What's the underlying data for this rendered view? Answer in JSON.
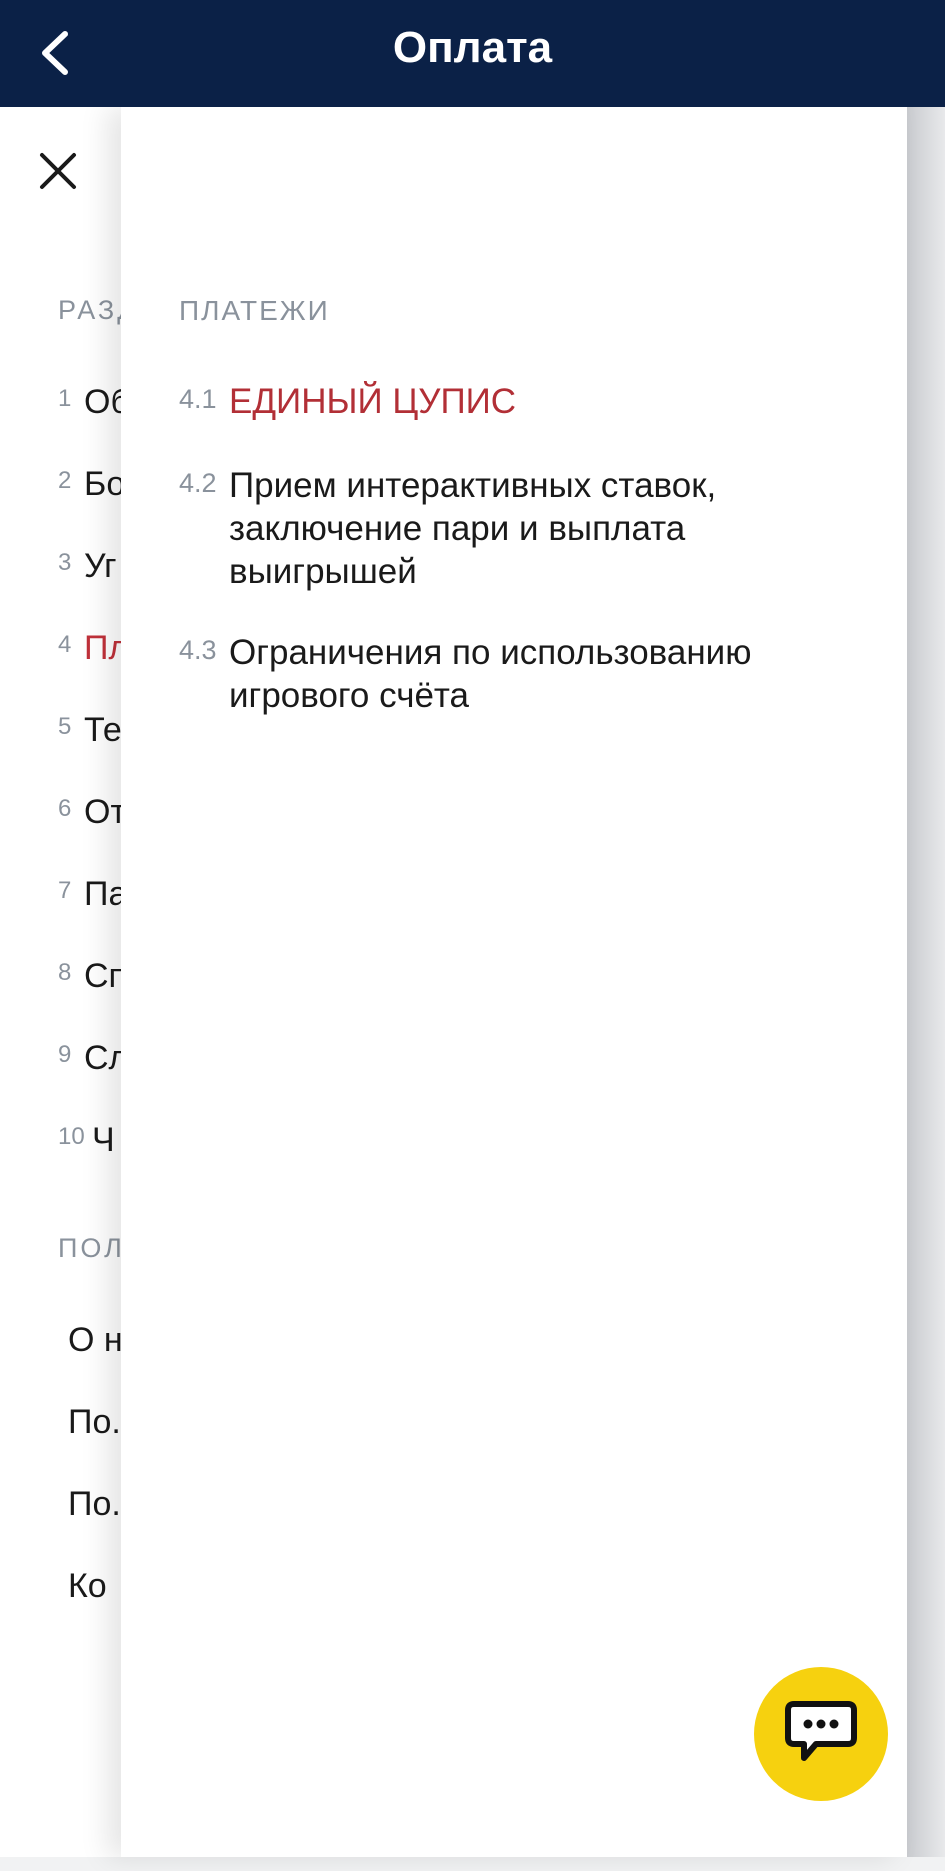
{
  "header": {
    "title": "Оплата"
  },
  "background_menu": {
    "sections_title": "РАЗД",
    "items": [
      {
        "num": "1",
        "label": "Об"
      },
      {
        "num": "2",
        "label": "Бо"
      },
      {
        "num": "3",
        "label": "Уг"
      },
      {
        "num": "4",
        "label": "Пл",
        "active": true
      },
      {
        "num": "5",
        "label": "Те"
      },
      {
        "num": "6",
        "label": "От"
      },
      {
        "num": "7",
        "label": "Па"
      },
      {
        "num": "8",
        "label": "Сп"
      },
      {
        "num": "9",
        "label": "Сл"
      },
      {
        "num": "10",
        "label": "Ч"
      }
    ],
    "useful_title": "ПОЛ",
    "links": [
      "О н",
      "По.",
      "По.",
      "Ко"
    ]
  },
  "sheet": {
    "title": "ПЛАТЕЖИ",
    "items": [
      {
        "num": "4.1",
        "label": "ЕДИНЫЙ ЦУПИС",
        "active": true
      },
      {
        "num": "4.2",
        "label": "Прием интерактивных ставок, заключение пари и выплата выигрышей"
      },
      {
        "num": "4.3",
        "label": "Ограничения по использованию игрового счёта"
      }
    ]
  },
  "colors": {
    "header_bg": "#0b2147",
    "active_text": "#b22f36",
    "chat_button": "#f6d10f"
  },
  "icons": {
    "back": "chevron-left-icon",
    "close": "close-icon",
    "chat": "chat-bubble-icon"
  }
}
